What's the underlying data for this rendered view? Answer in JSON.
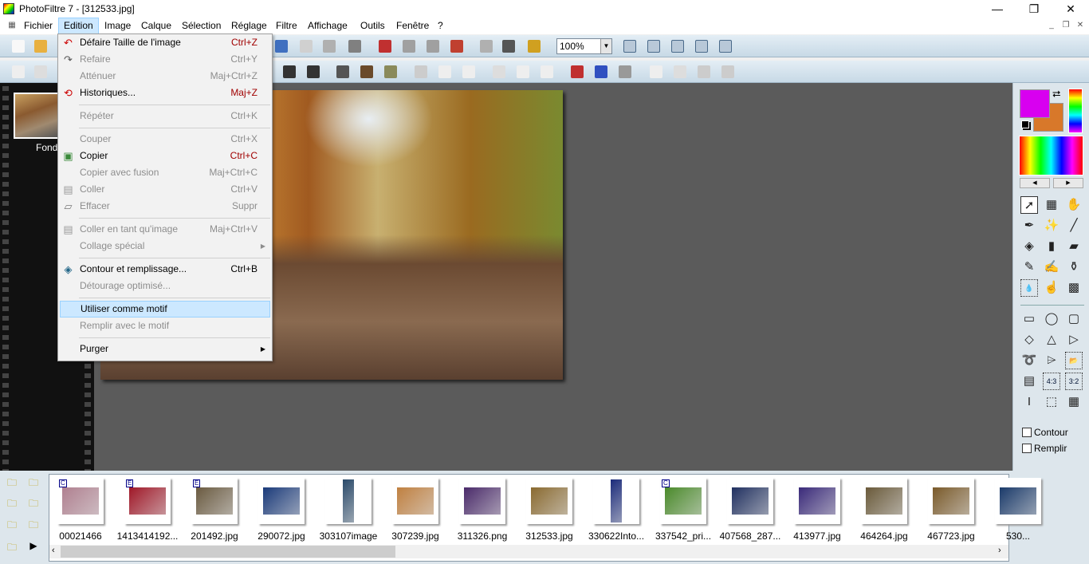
{
  "window": {
    "title": "PhotoFiltre 7 - [312533.jpg]",
    "minimize": "—",
    "maximize": "❐",
    "close": "✕"
  },
  "menubar": [
    "Fichier",
    "Edition",
    "Image",
    "Calque",
    "Sélection",
    "Réglage",
    "Filtre",
    "Affichage",
    "Outils",
    "Fenêtre",
    "?"
  ],
  "zoom": "100%",
  "edition_menu": [
    {
      "label": "Défaire Taille de l'image",
      "shortcut": "Ctrl+Z",
      "icon": "undo-icon",
      "glyph": "↶",
      "color": "#c00",
      "red": true
    },
    {
      "label": "Refaire",
      "shortcut": "Ctrl+Y",
      "icon": "redo-icon",
      "glyph": "↷",
      "disabled": true
    },
    {
      "label": "Atténuer",
      "shortcut": "Maj+Ctrl+Z",
      "disabled": true
    },
    {
      "label": "Historiques...",
      "shortcut": "Maj+Z",
      "icon": "history-icon",
      "glyph": "⟲",
      "color": "#c00",
      "red": true
    },
    {
      "sep": true
    },
    {
      "label": "Répéter",
      "shortcut": "Ctrl+K",
      "disabled": true
    },
    {
      "sep": true
    },
    {
      "label": "Couper",
      "shortcut": "Ctrl+X",
      "disabled": true
    },
    {
      "label": "Copier",
      "shortcut": "Ctrl+C",
      "icon": "copy-icon",
      "glyph": "▣",
      "color": "#3a8a3a",
      "red": true
    },
    {
      "label": "Copier avec fusion",
      "shortcut": "Maj+Ctrl+C",
      "disabled": true
    },
    {
      "label": "Coller",
      "shortcut": "Ctrl+V",
      "icon": "paste-icon",
      "glyph": "▤",
      "color": "#999",
      "disabled": true
    },
    {
      "label": "Effacer",
      "shortcut": "Suppr",
      "icon": "eraser-icon",
      "glyph": "▱",
      "color": "#777",
      "disabled": true
    },
    {
      "sep": true
    },
    {
      "label": "Coller en tant qu'image",
      "shortcut": "Maj+Ctrl+V",
      "icon": "paste-as-image-icon",
      "glyph": "▤",
      "color": "#999",
      "disabled": true
    },
    {
      "label": "Collage spécial",
      "submenu": true,
      "disabled": true
    },
    {
      "sep": true
    },
    {
      "label": "Contour et remplissage...",
      "shortcut": "Ctrl+B",
      "icon": "fill-icon",
      "glyph": "◈",
      "color": "#268"
    },
    {
      "label": "Détourage optimisé...",
      "disabled": true
    },
    {
      "sep": true
    },
    {
      "label": "Utiliser comme motif",
      "highlighted": true
    },
    {
      "label": "Remplir avec le motif",
      "disabled": true
    },
    {
      "sep": true
    },
    {
      "label": "Purger",
      "submenu": true
    }
  ],
  "layer": {
    "label": "Fond"
  },
  "colors": {
    "foreground": "#d800f0",
    "background": "#d8782a"
  },
  "options": {
    "contour": "Contour",
    "remplir": "Remplir",
    "contour_checked": false,
    "remplir_checked": false
  },
  "browser": {
    "files": [
      {
        "name": "00021466",
        "badge": "C",
        "c": "#b08090"
      },
      {
        "name": "1413414192...",
        "badge": "E",
        "c": "#a01828"
      },
      {
        "name": "201492.jpg",
        "badge": "E",
        "c": "#6a5a40"
      },
      {
        "name": "290072.jpg",
        "c": "#1a3a7a"
      },
      {
        "name": "303107image",
        "c": "#2a4a6a",
        "narrow": true
      },
      {
        "name": "307239.jpg",
        "c": "#c08040"
      },
      {
        "name": "311326.png",
        "c": "#4a2a6a"
      },
      {
        "name": "312533.jpg",
        "c": "#8a6a30"
      },
      {
        "name": "330622Into...",
        "c": "#1a2a7a",
        "narrow": true
      },
      {
        "name": "337542_pri...",
        "badge": "C",
        "c": "#4a8a2a"
      },
      {
        "name": "407568_287...",
        "c": "#203060"
      },
      {
        "name": "413977.jpg",
        "c": "#3a2a7a"
      },
      {
        "name": "464264.jpg",
        "c": "#6a5a3a"
      },
      {
        "name": "467723.jpg",
        "c": "#7a5a2a"
      },
      {
        "name": "530...",
        "c": "#1a3a6a"
      }
    ]
  }
}
